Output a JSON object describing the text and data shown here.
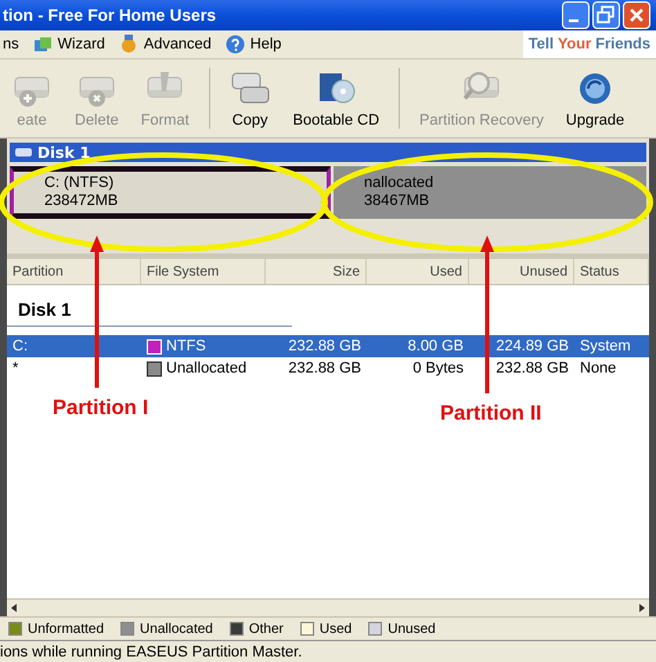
{
  "window": {
    "title": "tion - Free For Home Users"
  },
  "menu": [
    {
      "label": "ns",
      "kind": "plain"
    },
    {
      "label": "Wizard",
      "kind": "wizard"
    },
    {
      "label": "Advanced",
      "kind": "advanced"
    },
    {
      "label": "Help",
      "kind": "help"
    }
  ],
  "tell_friends": [
    {
      "text": "Tell",
      "color": "#4f79a8"
    },
    {
      "text": "Your",
      "color": "#e0603a"
    },
    {
      "text": "Friends",
      "color": "#4f79a8"
    }
  ],
  "toolbar": [
    [
      {
        "label": "eate",
        "kind": "create",
        "disabled": true
      },
      {
        "label": "Delete",
        "kind": "delete",
        "disabled": true
      },
      {
        "label": "Format",
        "kind": "format",
        "disabled": true
      }
    ],
    [
      {
        "label": "Copy",
        "kind": "copy",
        "disabled": false
      },
      {
        "label": "Bootable CD",
        "kind": "cd",
        "disabled": false
      }
    ],
    [
      {
        "label": "Partition Recovery",
        "kind": "recovery",
        "disabled": true
      },
      {
        "label": "Upgrade",
        "kind": "upgrade",
        "disabled": false
      }
    ]
  ],
  "disk_map": {
    "title": "Disk 1",
    "partitions": [
      {
        "name": "C: (NTFS)",
        "size": "238472MB",
        "kind": "ntfs"
      },
      {
        "name": "nallocated",
        "size": "38467MB",
        "kind": "unallocated"
      }
    ]
  },
  "table": {
    "columns": [
      "Partition",
      "File System",
      "Size",
      "Used",
      "Unused",
      "Status"
    ],
    "groups": [
      {
        "label": "Disk 1",
        "rows": [
          {
            "partition": "C:",
            "file_system": "NTFS",
            "color": "#c020c0",
            "size": "232.88 GB",
            "used": "8.00 GB",
            "unused": "224.89 GB",
            "status": "System",
            "selected": true
          },
          {
            "partition": "*",
            "file_system": "Unallocated",
            "color": "#8a8a8a",
            "size": "232.88 GB",
            "used": "0 Bytes",
            "unused": "232.88 GB",
            "status": "None",
            "selected": false
          }
        ]
      }
    ]
  },
  "legend": [
    {
      "label": "Unformatted",
      "color": "#7a8a1a"
    },
    {
      "label": "Unallocated",
      "color": "#8e8e8e"
    },
    {
      "label": "Other",
      "color": "#3a3a3a"
    },
    {
      "label": "Used",
      "color": "#fbf6d8"
    },
    {
      "label": "Unused",
      "color": "#d4d4de"
    }
  ],
  "annotations": [
    {
      "label": "Partition I"
    },
    {
      "label": "Partition II"
    }
  ],
  "status_bar": {
    "text": "ions while running EASEUS Partition Master."
  }
}
